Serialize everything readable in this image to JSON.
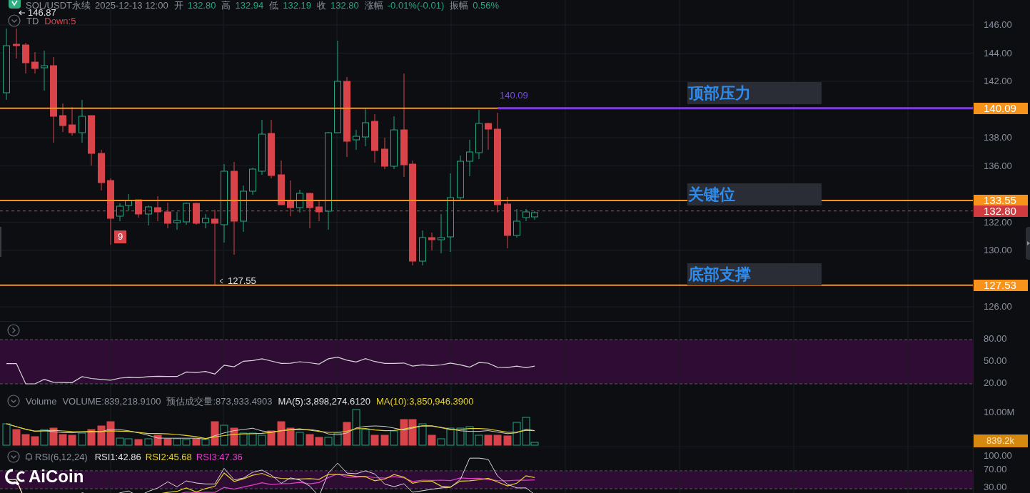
{
  "header": {
    "symbol": "SOL/USDT永续",
    "datetime": "2025-12-13 12:00",
    "fields": [
      {
        "label": "开",
        "value": "132.80"
      },
      {
        "label": "高",
        "value": "132.94"
      },
      {
        "label": "低",
        "value": "132.19"
      },
      {
        "label": "收",
        "value": "132.80"
      },
      {
        "label": "涨幅",
        "value": "-0.01%(-0.01)"
      },
      {
        "label": "振幅",
        "value": "0.56%"
      }
    ]
  },
  "high_marker": "146.87",
  "td_indicator": {
    "name": "TD",
    "value": "Down:5"
  },
  "td_count": "9",
  "low_marker": "127.55",
  "ray_label": "140.09",
  "annotations": [
    {
      "text": "顶部压力"
    },
    {
      "text": "关键位"
    },
    {
      "text": "底部支撑"
    }
  ],
  "price_axis": [
    "146.00",
    "144.00",
    "142.00",
    "138.00",
    "136.00",
    "132.00",
    "130.00",
    "126.00"
  ],
  "price_badges": [
    {
      "value": "140.09",
      "kind": "line"
    },
    {
      "value": "133.55",
      "kind": "line"
    },
    {
      "value": "132.80",
      "kind": "current"
    },
    {
      "value": "127.53",
      "kind": "line"
    }
  ],
  "oscillator_pane": {
    "axis": [
      "80.00",
      "50.00",
      "20.00"
    ]
  },
  "volume_pane": {
    "title": "Volume",
    "volume": "VOLUME:839,218.9100",
    "estimate": "预估成交量:873,933.4903",
    "ma5": "MA(5):3,898,274.6120",
    "ma10": "MA(10):3,850,946.3900",
    "axis": "10.00M",
    "badge": "839.2k"
  },
  "rsi_pane": {
    "title": "RSI(6,12,24)",
    "rsi1": "RSI1:42.86",
    "rsi2": "RSI2:45.68",
    "rsi3": "RSI3:47.36",
    "axis": [
      "100.00",
      "70.00",
      "30.00"
    ]
  },
  "logo": "AiCoin"
}
